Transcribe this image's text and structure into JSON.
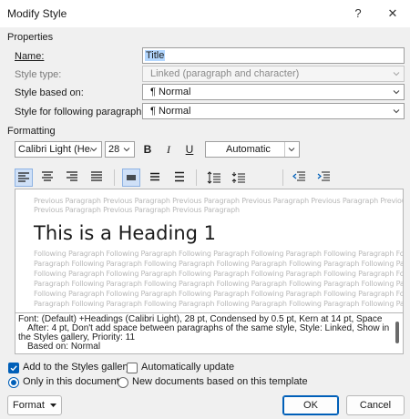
{
  "window": {
    "title": "Modify Style",
    "help_label": "?",
    "close_label": "✕"
  },
  "properties": {
    "heading": "Properties",
    "name_label": "Name:",
    "name_value": "Title",
    "style_type_label": "Style type:",
    "style_type_value": "Linked (paragraph and character)",
    "based_on_label": "Style based on:",
    "based_on_value": "¶  Normal",
    "following_label": "Style for following paragraph:",
    "following_value": "¶  Normal"
  },
  "formatting": {
    "heading": "Formatting",
    "font_value": "Calibri Light (Head",
    "size_value": "28",
    "bold_label": "B",
    "italic_label": "I",
    "underline_label": "U",
    "color_value": "Automatic"
  },
  "preview": {
    "previous_line_1": "Previous Paragraph Previous Paragraph Previous Paragraph Previous Paragraph Previous Paragraph Previous Paragraph",
    "previous_line_2": "Previous Paragraph Previous Paragraph Previous Paragraph",
    "heading_text": "This is a Heading 1",
    "following_lines": [
      "Following Paragraph Following Paragraph Following Paragraph Following Paragraph Following Paragraph Following",
      "Paragraph Following Paragraph Following Paragraph Following Paragraph Following Paragraph Following Paragraph",
      "Following Paragraph Following Paragraph Following Paragraph Following Paragraph Following Paragraph Following",
      "Paragraph Following Paragraph Following Paragraph Following Paragraph Following Paragraph Following Paragraph",
      "Following Paragraph Following Paragraph Following Paragraph Following Paragraph Following Paragraph Following",
      "Paragraph Following Paragraph Following Paragraph Following Paragraph Following Paragraph Following Paragraph"
    ]
  },
  "description": {
    "line_1": "Font: (Default) +Headings (Calibri Light), 28 pt, Condensed by  0.5 pt, Kern at 14 pt, Space",
    "line_2": "After:  4 pt, Don't add space between paragraphs of the same style, Style: Linked, Show in",
    "line_3": "the Styles gallery, Priority: 11",
    "line_4": "Based on: Normal"
  },
  "options": {
    "add_to_gallery_label": "Add to the Styles gallery",
    "add_to_gallery_checked": true,
    "auto_update_label": "Automatically update",
    "auto_update_checked": false,
    "only_this_doc_label": "Only in this document",
    "only_this_doc_selected": true,
    "new_docs_label": "New documents based on this template",
    "new_docs_selected": false
  },
  "buttons": {
    "format_label": "Format",
    "ok_label": "OK",
    "cancel_label": "Cancel"
  },
  "colors": {
    "accent": "#005fb8",
    "selection": "#b3d7ff",
    "dialog_bg": "#f0f0f0"
  }
}
